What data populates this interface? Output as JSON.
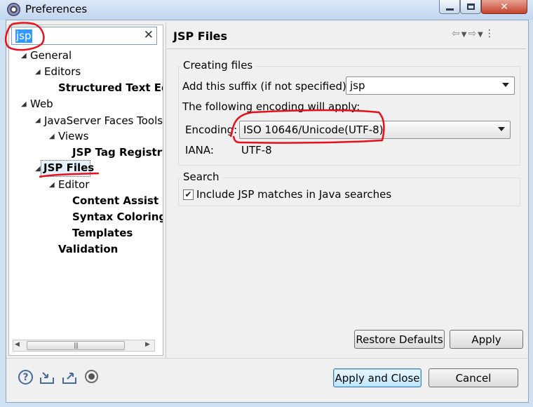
{
  "window": {
    "title": "Preferences",
    "app_icon": "eclipse-icon"
  },
  "filter": {
    "value": "jsp"
  },
  "tree": [
    {
      "label": "General",
      "bold": false
    },
    {
      "label": "Editors",
      "bold": false
    },
    {
      "label": "Structured Text Ed",
      "bold": true
    },
    {
      "label": "Web",
      "bold": false
    },
    {
      "label": "JavaServer Faces Tools",
      "bold": false
    },
    {
      "label": "Views",
      "bold": false
    },
    {
      "label": "JSP Tag Registry",
      "bold": true
    },
    {
      "label": "JSP Files",
      "bold": true,
      "selected": true
    },
    {
      "label": "Editor",
      "bold": false
    },
    {
      "label": "Content Assist",
      "bold": true
    },
    {
      "label": "Syntax Coloring",
      "bold": true
    },
    {
      "label": "Templates",
      "bold": true
    },
    {
      "label": "Validation",
      "bold": true
    }
  ],
  "page": {
    "title": "JSP Files",
    "creating": {
      "group_label": "Creating files",
      "suffix_label": "Add this suffix (if not specified):",
      "suffix_value": "jsp",
      "encoding_note": "The following encoding will apply:",
      "encoding_label": "Encoding:",
      "encoding_value": "ISO 10646/Unicode(UTF-8)",
      "iana_label": "IANA:",
      "iana_value": "UTF-8"
    },
    "search": {
      "group_label": "Search",
      "checkbox_label": "Include JSP matches in Java searches",
      "checked": true
    },
    "restore_label": "Restore Defaults",
    "apply_label": "Apply"
  },
  "footer": {
    "apply_close_label": "Apply and Close",
    "cancel_label": "Cancel"
  },
  "colors": {
    "annotation": "#e8101a",
    "selection": "#3399ff",
    "button_default_border": "#3c7fb1"
  }
}
